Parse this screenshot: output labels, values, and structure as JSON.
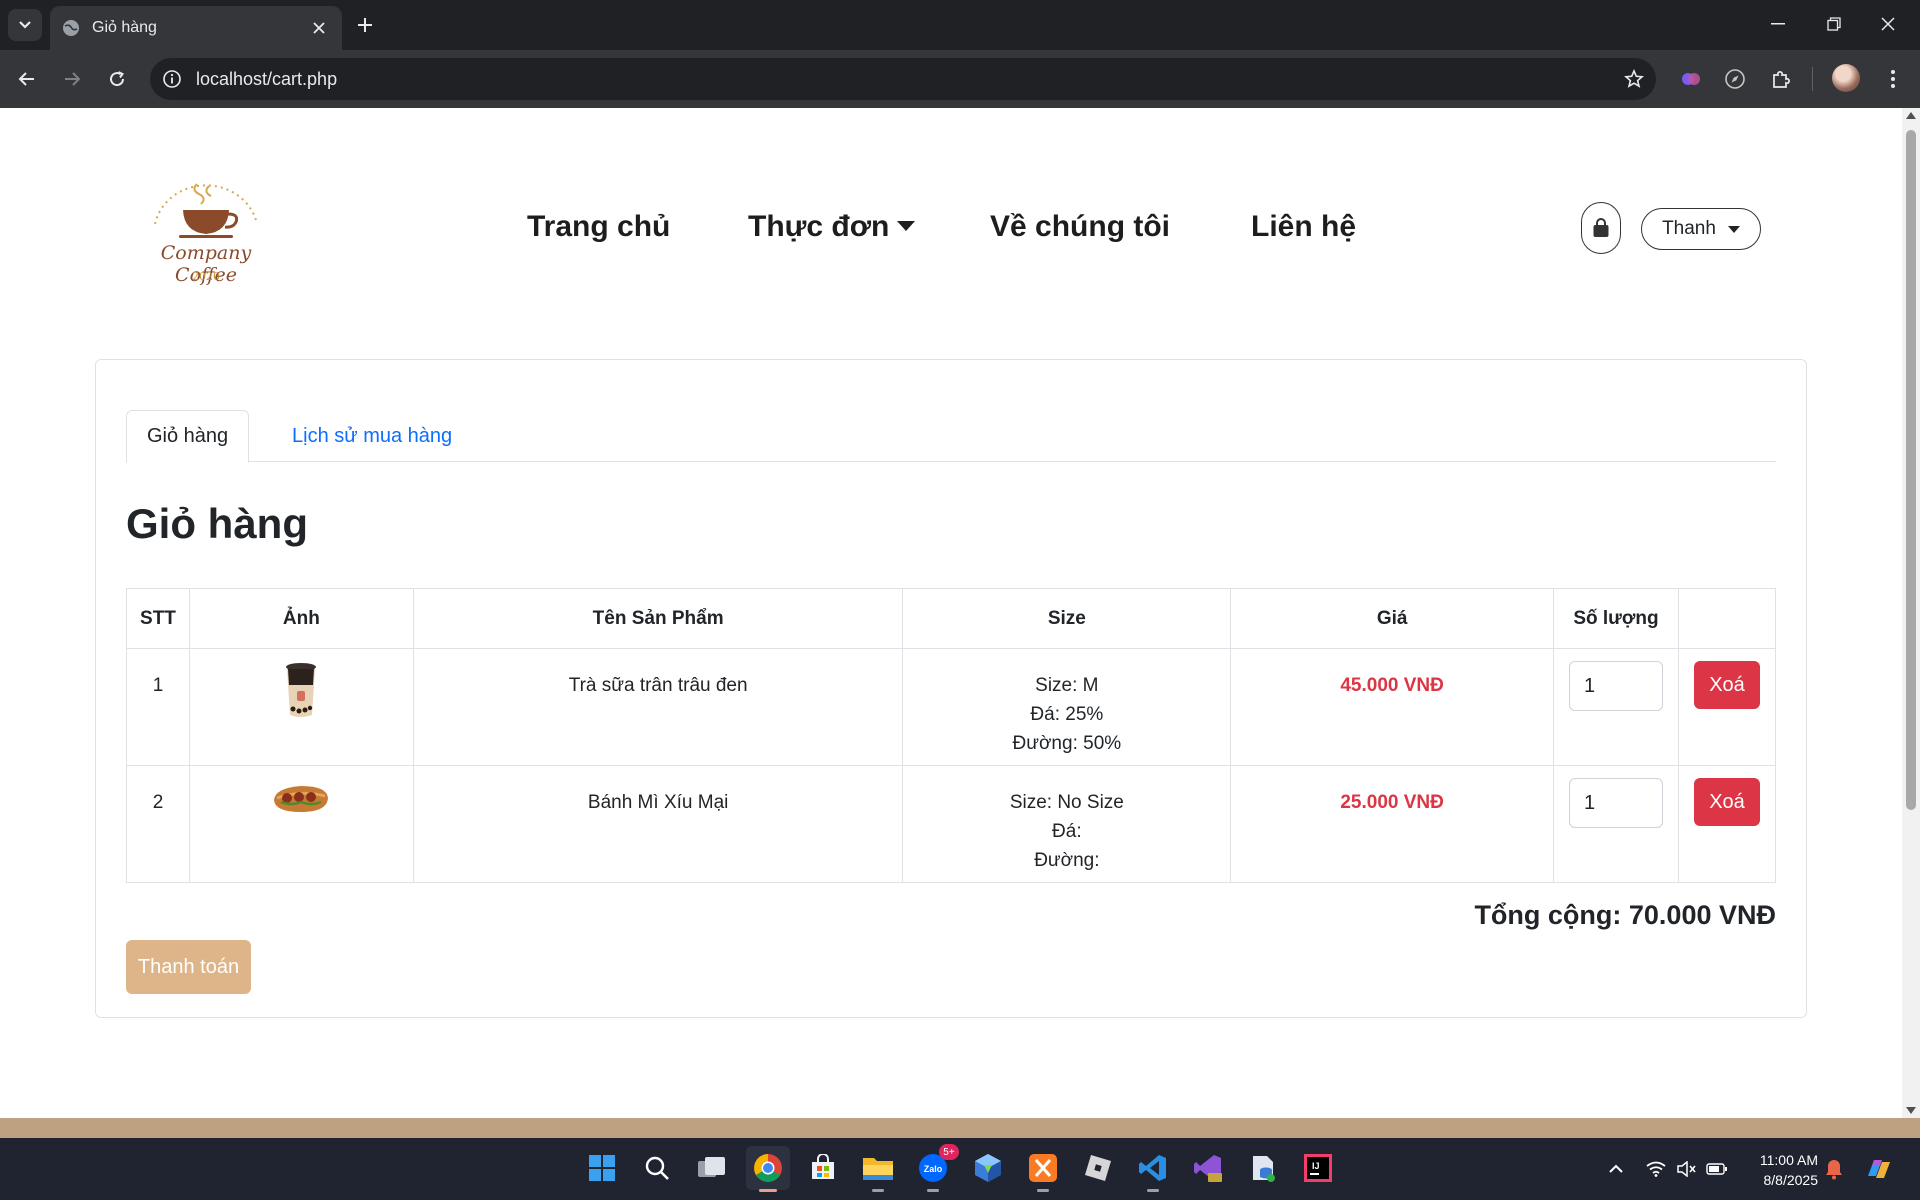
{
  "browser": {
    "tab_title": "Giỏ hàng",
    "url": "localhost/cart.php"
  },
  "site": {
    "logo_text": "Company Coffee",
    "logo_year": "2020",
    "nav": {
      "home": "Trang chủ",
      "menu": "Thực đơn",
      "about": "Về chúng tôi",
      "contact": "Liên hệ"
    },
    "user_name": "Thanh"
  },
  "cart": {
    "tabs": {
      "cart": "Giỏ hàng",
      "history": "Lịch sử mua hàng"
    },
    "title": "Giỏ hàng",
    "headers": {
      "stt": "STT",
      "image": "Ảnh",
      "name": "Tên Sản Phẩm",
      "size": "Size",
      "price": "Giá",
      "qty": "Số lượng"
    },
    "rows": [
      {
        "stt": "1",
        "name": "Trà sữa trân trâu đen",
        "size": "Size: M",
        "ice": "Đá: 25%",
        "sugar": "Đường: 50%",
        "price": "45.000 VNĐ",
        "qty": "1",
        "delete": "Xoá"
      },
      {
        "stt": "2",
        "name": "Bánh Mì Xíu Mại",
        "size": "Size: No Size",
        "ice": "Đá:",
        "sugar": "Đường:",
        "price": "25.000 VNĐ",
        "qty": "1",
        "delete": "Xoá"
      }
    ],
    "total": "Tổng cộng: 70.000 VNĐ",
    "checkout": "Thanh toán"
  },
  "taskbar": {
    "zalo_badge": "5+",
    "time": "11:00 AM",
    "date": "8/8/2025"
  },
  "colors": {
    "price": "#dc3545",
    "delete_button": "#dc3545",
    "checkout_button": "#ddb589",
    "tab_link": "#0d6efd",
    "footer": "#b39a7c"
  }
}
